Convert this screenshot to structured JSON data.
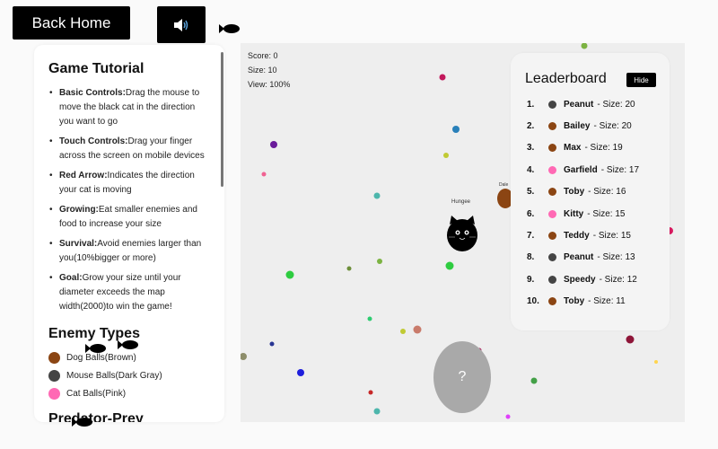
{
  "back_home_label": "Back Home",
  "sound_icon": "speaker-icon",
  "stats": {
    "score": "Score: 0",
    "size": "Size: 10",
    "view": "View: 100%"
  },
  "tutorial": {
    "title": "Game Tutorial",
    "items": [
      {
        "label": "Basic Controls:",
        "text": "Drag the mouse to move the black cat in the direction you want to go"
      },
      {
        "label": "Touch Controls:",
        "text": "Drag your finger across the screen on mobile devices"
      },
      {
        "label": "Red Arrow:",
        "text": "Indicates the direction your cat is moving"
      },
      {
        "label": "Growing:",
        "text": "Eat smaller enemies and food to increase your size"
      },
      {
        "label": "Survival:",
        "text": "Avoid enemies larger than you(10%bigger or more)"
      },
      {
        "label": "Goal:",
        "text": "Grow your size until your diameter exceeds the map width(2000)to win the game!"
      }
    ],
    "enemy_types_title": "Enemy Types",
    "enemy_types": [
      {
        "label": "Dog Balls(Brown)",
        "color": "#8B4513"
      },
      {
        "label": "Mouse Balls(Dark Gray)",
        "color": "#444444"
      },
      {
        "label": "Cat Balls(Pink)",
        "color": "#FF69B4"
      }
    ],
    "predator_title": "Predator-Prey"
  },
  "leaderboard": {
    "title": "Leaderboard",
    "hide_label": "Hide",
    "rows": [
      {
        "rank": "1.",
        "name": "Peanut",
        "size": " - Size: 20",
        "color": "#444444"
      },
      {
        "rank": "2.",
        "name": "Bailey",
        "size": " - Size: 20",
        "color": "#8B4513"
      },
      {
        "rank": "3.",
        "name": "Max",
        "size": " - Size: 19",
        "color": "#8B4513"
      },
      {
        "rank": "4.",
        "name": "Garfield",
        "size": " - Size: 17",
        "color": "#FF69B4"
      },
      {
        "rank": "5.",
        "name": "Toby",
        "size": " - Size: 16",
        "color": "#8B4513"
      },
      {
        "rank": "6.",
        "name": "Kitty",
        "size": " - Size: 15",
        "color": "#FF69B4"
      },
      {
        "rank": "7.",
        "name": "Teddy",
        "size": " - Size: 15",
        "color": "#8B4513"
      },
      {
        "rank": "8.",
        "name": "Peanut",
        "size": " - Size: 13",
        "color": "#444444"
      },
      {
        "rank": "9.",
        "name": "Speedy",
        "size": " - Size: 12",
        "color": "#444444"
      },
      {
        "rank": "10.",
        "name": "Toby",
        "size": " - Size: 11",
        "color": "#8B4513"
      }
    ]
  },
  "player_label": "Hungee",
  "enemy_label": "Dale",
  "joystick_label": "?"
}
